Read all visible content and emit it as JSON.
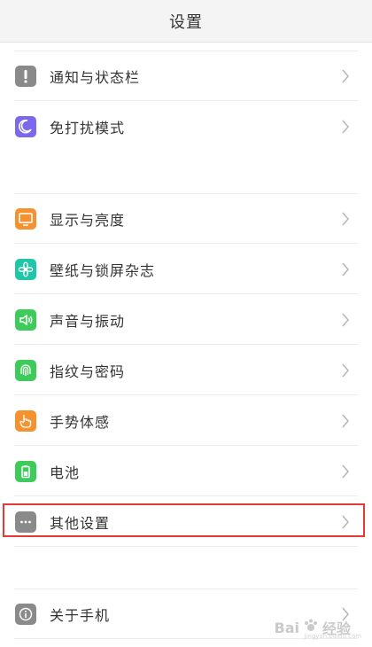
{
  "header": {
    "title": "设置"
  },
  "sections": [
    {
      "items": [
        {
          "label": "通知与状态栏",
          "icon": "notification-icon",
          "color": "#8a8a8a"
        },
        {
          "label": "免打扰模式",
          "icon": "moon-icon",
          "color": "#7b68ee"
        }
      ]
    },
    {
      "items": [
        {
          "label": "显示与亮度",
          "icon": "display-icon",
          "color": "#f5922f"
        },
        {
          "label": "壁纸与锁屏杂志",
          "icon": "wallpaper-icon",
          "color": "#1fc7a8"
        },
        {
          "label": "声音与振动",
          "icon": "sound-icon",
          "color": "#3fca5c"
        },
        {
          "label": "指纹与密码",
          "icon": "fingerprint-icon",
          "color": "#3fca5c"
        },
        {
          "label": "手势体感",
          "icon": "gesture-icon",
          "color": "#f5922f"
        },
        {
          "label": "电池",
          "icon": "battery-icon",
          "color": "#3fca5c"
        },
        {
          "label": "其他设置",
          "icon": "more-icon",
          "color": "#8a8a8a",
          "highlighted": true
        }
      ]
    },
    {
      "items": [
        {
          "label": "关于手机",
          "icon": "info-icon",
          "color": "#8a8a8a"
        }
      ]
    }
  ],
  "watermark": {
    "brand": "Bai",
    "brand2": "经验",
    "sub": "jingyan.baidu.com"
  },
  "colors": {
    "highlight_border": "#e53935",
    "chevron": "#b5b5b5"
  }
}
